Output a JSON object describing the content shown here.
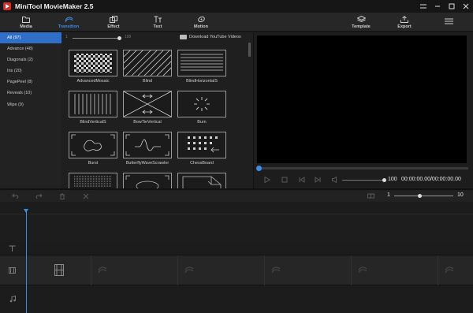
{
  "app": {
    "title": "MiniTool MovieMaker 2.5"
  },
  "toolbar": {
    "media": "Media",
    "transition": "Transition",
    "effect": "Effect",
    "text": "Text",
    "motion": "Motion",
    "template": "Template",
    "export": "Export"
  },
  "categories": [
    {
      "label": "All (97)"
    },
    {
      "label": "Advance (48)"
    },
    {
      "label": "Diagonals (2)"
    },
    {
      "label": "Iris (20)"
    },
    {
      "label": "PagePeel (8)"
    },
    {
      "label": "Reveals (10)"
    },
    {
      "label": "Wipe (9)"
    }
  ],
  "gallery": {
    "slider_min": "1",
    "slider_max": "100",
    "download_link": "Download YouTube Videos",
    "tiles": [
      {
        "name": "AdvancedMosaic"
      },
      {
        "name": "Blind"
      },
      {
        "name": "BlindHorizontalS"
      },
      {
        "name": "BlindVerticalS"
      },
      {
        "name": "BowTieVertical"
      },
      {
        "name": "Burn"
      },
      {
        "name": "Burst"
      },
      {
        "name": "ButterflyWaveScrawler"
      },
      {
        "name": "ChessBoard"
      }
    ]
  },
  "player": {
    "volume": "100",
    "timecode": "00:00:00.00/00:00:00.00",
    "progress": 0
  },
  "timeline": {
    "zoom_min": "1",
    "zoom_max": "10",
    "zoom_level": 0.42
  },
  "colors": {
    "accent": "#3b8de8",
    "selected": "#2f6fc7",
    "logo": "#d62b2b"
  }
}
